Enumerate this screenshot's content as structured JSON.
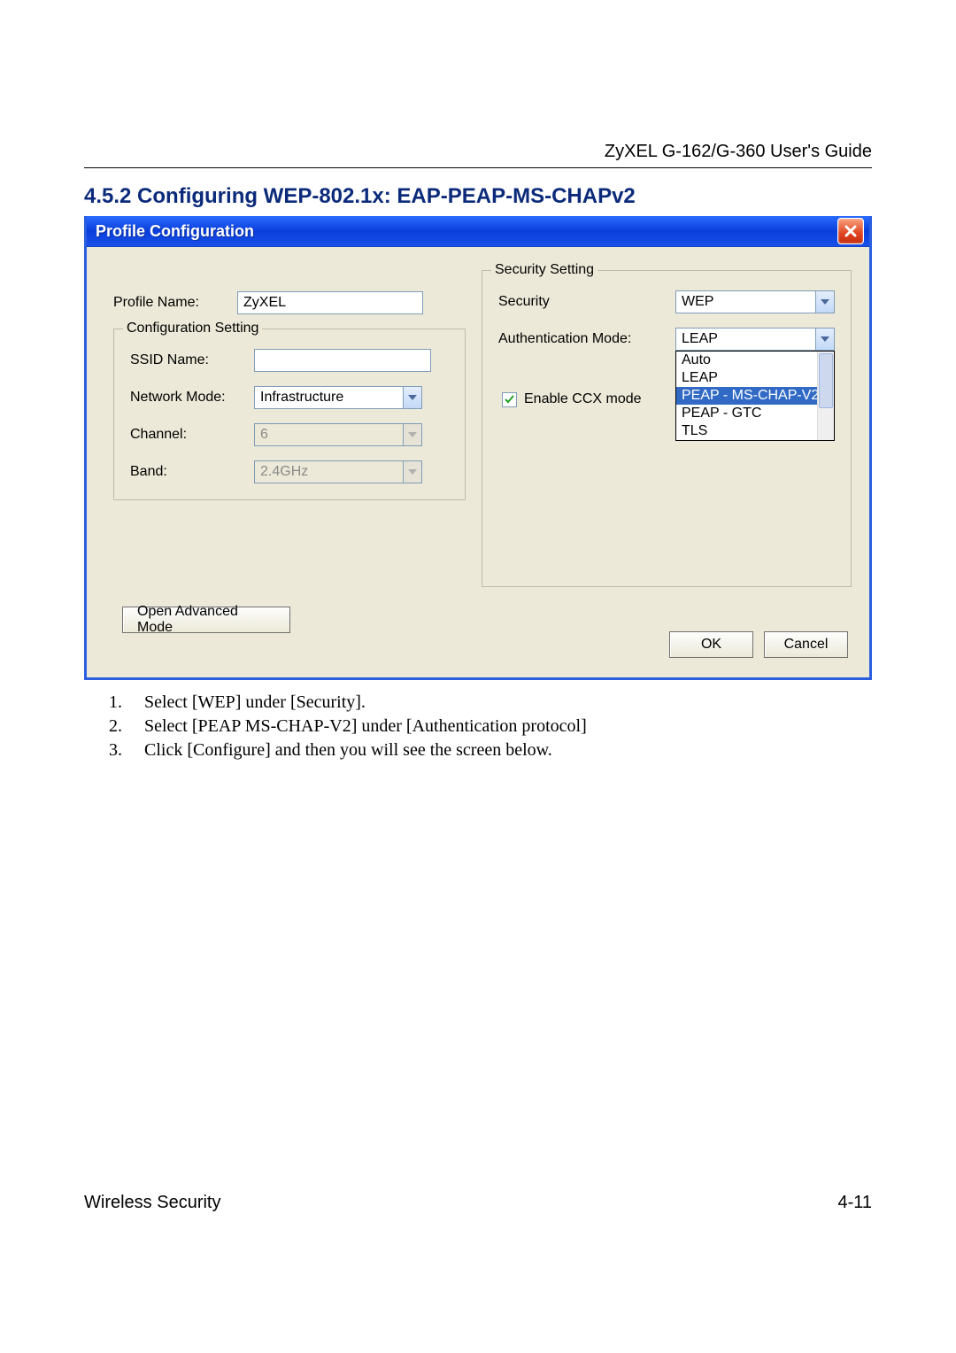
{
  "doc": {
    "header": "ZyXEL G-162/G-360 User's Guide",
    "section_heading": "4.5.2   Configuring WEP-802.1x: EAP-PEAP-MS-CHAPv2",
    "footer_left": "Wireless Security",
    "footer_right": "4-11"
  },
  "dialog": {
    "title": "Profile Configuration",
    "left": {
      "profile_name_label": "Profile Name:",
      "profile_name_value": "ZyXEL",
      "config_group_label": "Configuration Setting",
      "ssid_label": "SSID Name:",
      "ssid_value": "",
      "network_mode_label": "Network Mode:",
      "network_mode_value": "Infrastructure",
      "channel_label": "Channel:",
      "channel_value": "6",
      "band_label": "Band:",
      "band_value": "2.4GHz"
    },
    "right": {
      "group_label": "Security Setting",
      "security_label": "Security",
      "security_value": "WEP",
      "auth_mode_label": "Authentication Mode:",
      "auth_mode_value": "LEAP",
      "enable_ccx_label": "Enable CCX mode",
      "dd_options": [
        "Auto",
        "LEAP",
        "PEAP - MS-CHAP-V2",
        "PEAP - GTC",
        "TLS"
      ],
      "dd_selected_index": 2
    },
    "buttons": {
      "advanced": "Open Advanced Mode",
      "ok": "OK",
      "cancel": "Cancel"
    }
  },
  "instructions": [
    "Select [WEP] under [Security].",
    "Select [PEAP MS-CHAP-V2] under [Authentication protocol]",
    "Click [Configure] and then you will see the screen below."
  ]
}
